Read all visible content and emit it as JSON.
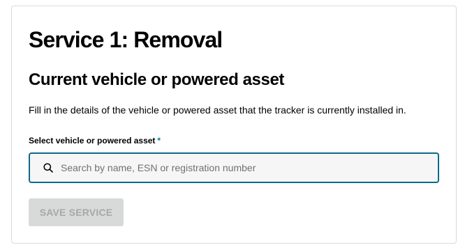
{
  "service": {
    "title": "Service 1: Removal"
  },
  "section": {
    "title": "Current vehicle or powered asset",
    "description": "Fill in the details of the vehicle or powered asset that the tracker is currently installed in."
  },
  "field": {
    "label": "Select vehicle or powered asset",
    "required_mark": "*",
    "search_icon": "search-icon",
    "value": "",
    "placeholder": "Search by name, ESN or registration number"
  },
  "actions": {
    "save_label": "SAVE SERVICE",
    "save_disabled": true
  },
  "colors": {
    "focus_border": "#0a6b8a",
    "required": "#0077b4",
    "disabled_bg": "#d8dada",
    "disabled_text": "#a7a7a7"
  }
}
